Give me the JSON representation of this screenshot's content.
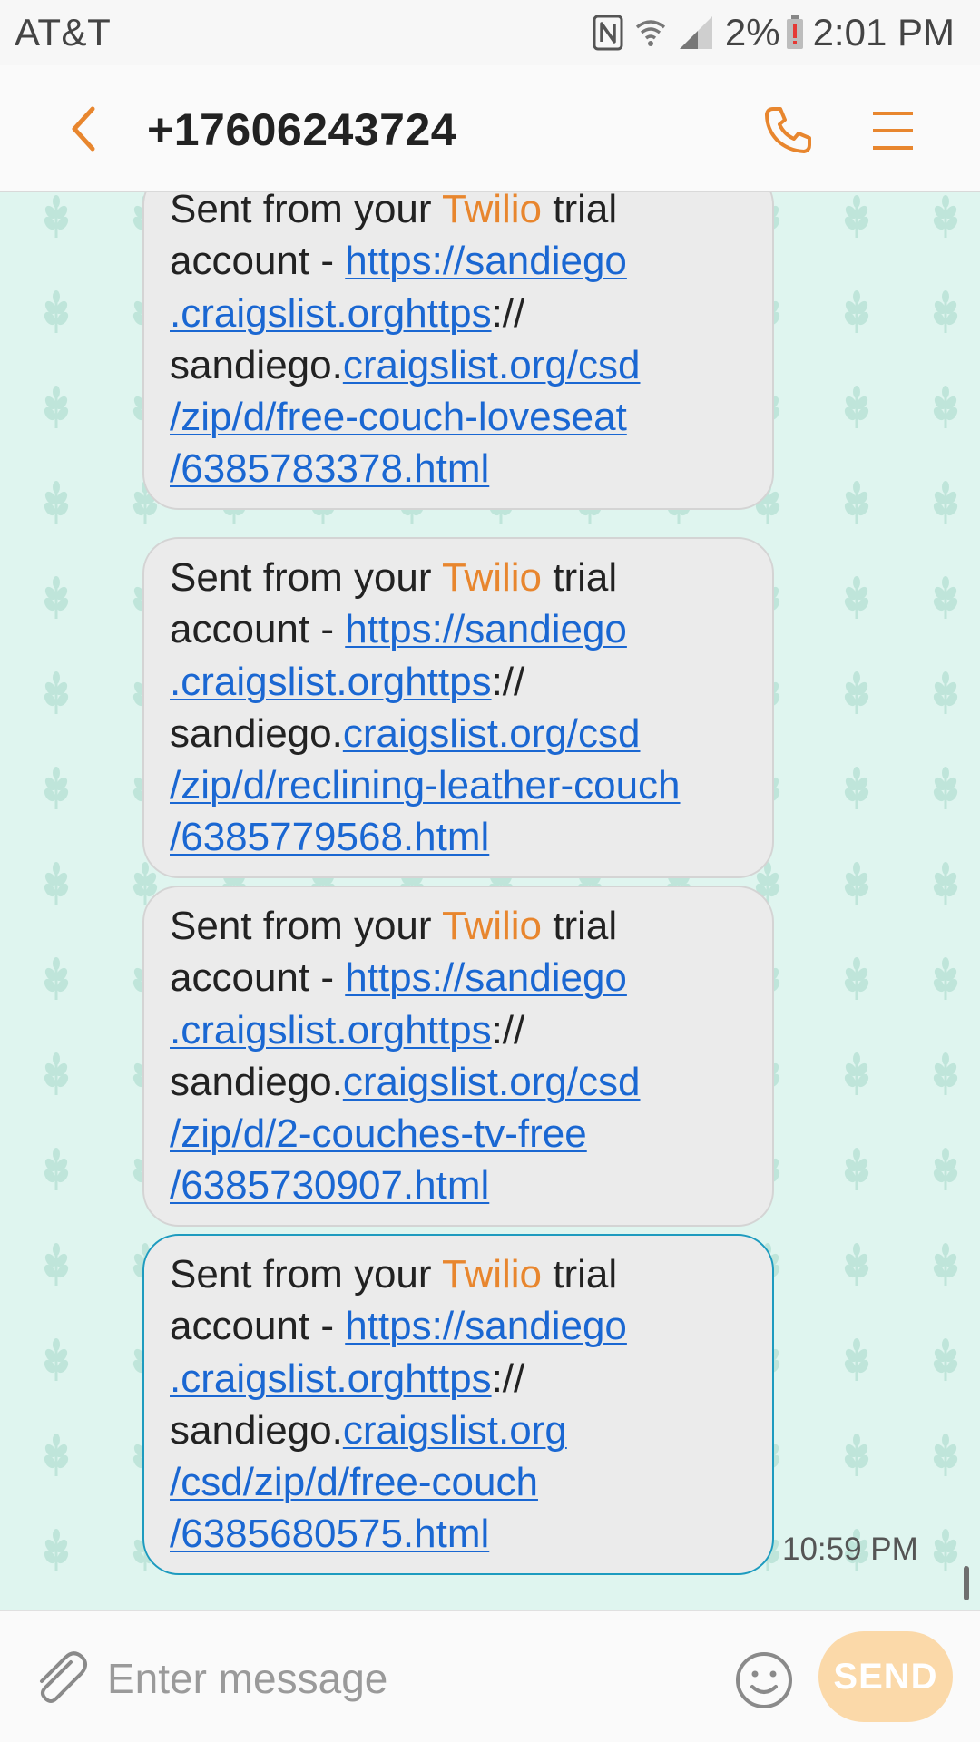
{
  "status_bar": {
    "carrier": "AT&T",
    "battery_percent": "2%",
    "time": "2:01 PM",
    "icons": [
      "nfc-icon",
      "wifi-icon",
      "signal-icon",
      "battery-low-icon"
    ]
  },
  "header": {
    "contact": "+17606243724",
    "back_icon": "chevron-left-icon",
    "call_icon": "phone-icon",
    "menu_icon": "menu-icon"
  },
  "messages": [
    {
      "prefix": "Sent from your ",
      "brand": "Twilio",
      "suffix": " trial",
      "line2_text": "account - ",
      "line2_link": "https://sandiego",
      "line3_link": ".craigslist.orghttps",
      "line3_text": "://",
      "line4_text": "sandiego.",
      "line4_link": "craigslist.org/csd",
      "line5_link": "/zip/d/free-couch-loveseat",
      "line6_link": "/6385783378.html"
    },
    {
      "prefix": "Sent from your ",
      "brand": "Twilio",
      "suffix": " trial",
      "line2_text": "account - ",
      "line2_link": "https://sandiego",
      "line3_link": ".craigslist.orghttps",
      "line3_text": "://",
      "line4_text": "sandiego.",
      "line4_link": "craigslist.org/csd",
      "line5_link": "/zip/d/reclining-leather-couch",
      "line6_link": "/6385779568.html"
    },
    {
      "prefix": "Sent from your ",
      "brand": "Twilio",
      "suffix": " trial",
      "line2_text": "account - ",
      "line2_link": "https://sandiego",
      "line3_link": ".craigslist.orghttps",
      "line3_text": "://",
      "line4_text": "sandiego.",
      "line4_link": "craigslist.org/csd",
      "line5_link": "/zip/d/2-couches-tv-free",
      "line6_link": "/6385730907.html"
    },
    {
      "prefix": "Sent from your ",
      "brand": "Twilio",
      "suffix": " trial",
      "line2_text": "account - ",
      "line2_link": "https://sandiego",
      "line3_link": ".craigslist.orghttps",
      "line3_text": "://",
      "line4_text": "sandiego.",
      "line4_link": "craigslist.org",
      "line5_link": "/csd/zip/d/free-couch",
      "line6_link": "/6385680575.html",
      "timestamp": "10:59 PM"
    }
  ],
  "input": {
    "placeholder": "Enter message",
    "send_label": "SEND",
    "attach_icon": "paperclip-icon",
    "emoji_icon": "emoji-icon"
  },
  "colors": {
    "accent": "#e8862e",
    "link": "#1a67d2",
    "bubble": "#ebebeb",
    "selected_border": "#1d9bbf",
    "background": "#dff5ef",
    "send_button": "#fbd9a9"
  }
}
